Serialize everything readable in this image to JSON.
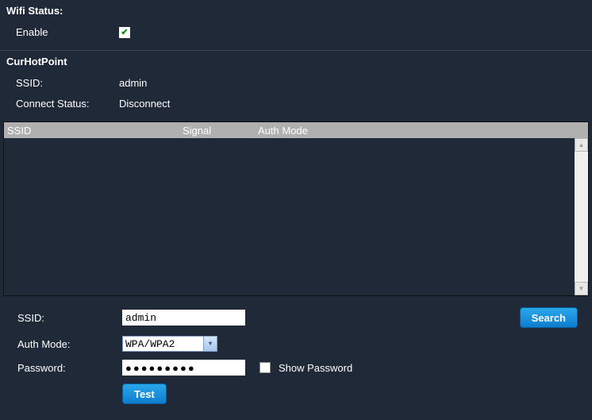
{
  "wifi_status": {
    "title": "Wifi Status:",
    "enable_label": "Enable",
    "enable_checked": true
  },
  "hotpoint": {
    "title": "CurHotPoint",
    "ssid_label": "SSID:",
    "ssid_value": "admin",
    "connect_label": "Connect Status:",
    "connect_value": "Disconnect"
  },
  "list": {
    "col_ssid": "SSID",
    "col_signal": "Signal",
    "col_auth": "Auth Mode",
    "rows": []
  },
  "form": {
    "ssid_label": "SSID:",
    "ssid_value": "admin",
    "auth_label": "Auth Mode:",
    "auth_value": "WPA/WPA2",
    "password_label": "Password:",
    "password_value": "●●●●●●●●●",
    "show_password_label": "Show Password",
    "show_password_checked": false,
    "search_label": "Search",
    "test_label": "Test"
  }
}
